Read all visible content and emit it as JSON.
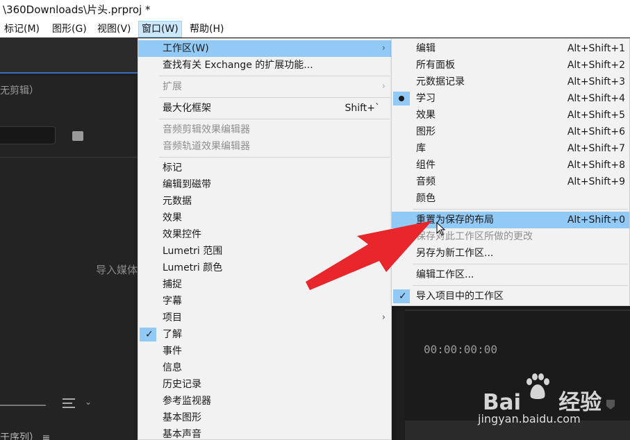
{
  "window": {
    "title": "\\360Downloads\\片头.prproj *"
  },
  "menubar": {
    "items": [
      {
        "label": "标记(M)"
      },
      {
        "label": "图形(G)"
      },
      {
        "label": "视图(V)"
      },
      {
        "label": "窗口(W)"
      },
      {
        "label": "帮助(H)"
      }
    ]
  },
  "background": {
    "panel_title": "无剪辑）",
    "import_text": "导入媒体",
    "bottom_tab": "于序列） ≡",
    "timecode": "00:00:00:00"
  },
  "window_menu": {
    "items": [
      {
        "label": "工作区(W)",
        "submenu": true,
        "highlighted": true
      },
      {
        "label": "查找有关 Exchange 的扩展功能..."
      },
      {
        "label": "扩展",
        "submenu": true,
        "disabled": true
      },
      {
        "label": "最大化框架",
        "shortcut": "Shift+`"
      },
      {
        "label": "音频剪辑效果编辑器",
        "disabled": true
      },
      {
        "label": "音频轨道效果编辑器",
        "disabled": true
      },
      {
        "label": "标记"
      },
      {
        "label": "编辑到磁带"
      },
      {
        "label": "元数据"
      },
      {
        "label": "效果"
      },
      {
        "label": "效果控件"
      },
      {
        "label": "Lumetri 范围"
      },
      {
        "label": "Lumetri 颜色"
      },
      {
        "label": "捕捉"
      },
      {
        "label": "字幕"
      },
      {
        "label": "项目",
        "submenu": true
      },
      {
        "label": "了解",
        "checked": true
      },
      {
        "label": "事件"
      },
      {
        "label": "信息"
      },
      {
        "label": "历史记录"
      },
      {
        "label": "参考监视器"
      },
      {
        "label": "基本图形"
      },
      {
        "label": "基本声音"
      }
    ]
  },
  "workspace_menu": {
    "items": [
      {
        "label": "编辑",
        "shortcut": "Alt+Shift+1"
      },
      {
        "label": "所有面板",
        "shortcut": "Alt+Shift+2"
      },
      {
        "label": "元数据记录",
        "shortcut": "Alt+Shift+3"
      },
      {
        "label": "学习",
        "shortcut": "Alt+Shift+4",
        "selected": true
      },
      {
        "label": "效果",
        "shortcut": "Alt+Shift+5"
      },
      {
        "label": "图形",
        "shortcut": "Alt+Shift+6"
      },
      {
        "label": "库",
        "shortcut": "Alt+Shift+7"
      },
      {
        "label": "组件",
        "shortcut": "Alt+Shift+8"
      },
      {
        "label": "音频",
        "shortcut": "Alt+Shift+9"
      },
      {
        "label": "颜色"
      },
      {
        "label": "重置为保存的布局",
        "shortcut": "Alt+Shift+0",
        "highlighted": true
      },
      {
        "label": "保存对此工作区所做的更改",
        "disabled": true
      },
      {
        "label": "另存为新工作区..."
      },
      {
        "label": "编辑工作区..."
      },
      {
        "label": "导入项目中的工作区",
        "checked": true
      }
    ]
  },
  "icons": {
    "submenu_arrow": "chevron-right-icon",
    "check": "checkmark-icon",
    "radio": "radio-dot-icon",
    "search": "search-icon"
  },
  "watermark": {
    "brand_left": "Bai",
    "brand_right": "经验",
    "url": "jingyan.baidu.com"
  },
  "colors": {
    "menu_highlight": "#91c9f7",
    "arrow": "#e8262c",
    "menubar_active": "#cce8ff"
  }
}
